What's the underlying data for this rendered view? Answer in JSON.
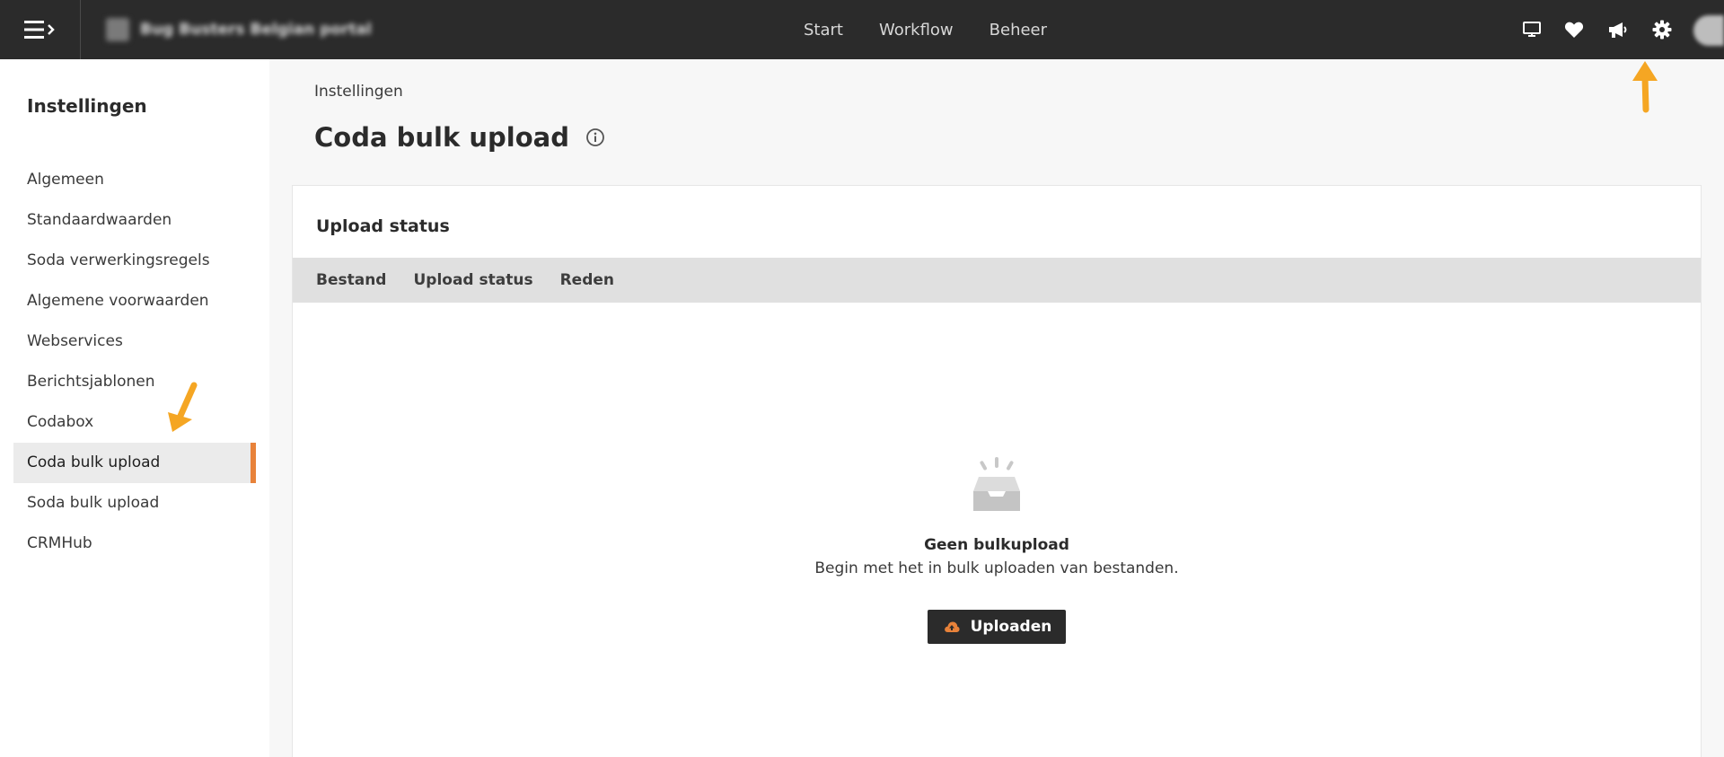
{
  "header": {
    "portal_name": "Bug Busters Belgian portal",
    "nav": [
      {
        "label": "Start"
      },
      {
        "label": "Workflow"
      },
      {
        "label": "Beheer"
      }
    ],
    "icons": [
      "monitor-icon",
      "heart-icon",
      "megaphone-icon",
      "gear-icon",
      "avatar"
    ]
  },
  "sidebar": {
    "title": "Instellingen",
    "items": [
      {
        "label": "Algemeen"
      },
      {
        "label": "Standaardwaarden"
      },
      {
        "label": "Soda verwerkingsregels"
      },
      {
        "label": "Algemene voorwaarden"
      },
      {
        "label": "Webservices"
      },
      {
        "label": "Berichtsjablonen"
      },
      {
        "label": "Codabox"
      },
      {
        "label": "Coda bulk upload",
        "active": true
      },
      {
        "label": "Soda bulk upload"
      },
      {
        "label": "CRMHub"
      }
    ]
  },
  "main": {
    "breadcrumb": "Instellingen",
    "title": "Coda bulk upload",
    "card": {
      "title": "Upload status",
      "columns": [
        "Bestand",
        "Upload status",
        "Reden"
      ],
      "empty": {
        "title": "Geen bulkupload",
        "text": "Begin met het in bulk uploaden van bestanden.",
        "button_label": "Uploaden"
      }
    }
  },
  "colors": {
    "topbar": "#2b2b2b",
    "accent": "#e8823a",
    "annotation_arrow": "#f5a623"
  }
}
